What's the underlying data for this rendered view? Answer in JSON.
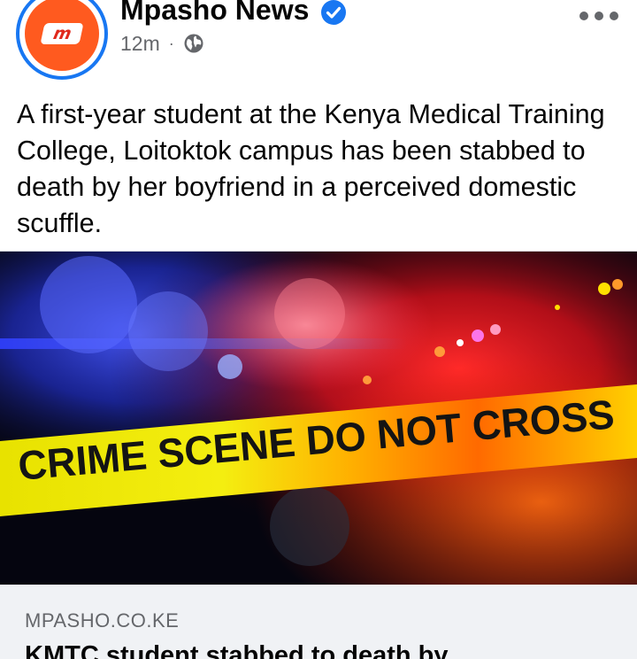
{
  "post": {
    "page_name": "Mpasho News",
    "verified": true,
    "timestamp": "12m",
    "separator": "·",
    "audience_icon": "globe-icon",
    "more_icon": "more-options-icon",
    "avatar_logo_text": "m",
    "text": "A first-year student at the Kenya Medical Training College, Loitoktok campus has been stabbed to death by her boyfriend in a perceived domestic scuffle."
  },
  "media": {
    "description_icon": "crime-scene-photo",
    "tape_text": "CRIME SCENE DO NOT CROSS"
  },
  "link_preview": {
    "domain": "MPASHO.CO.KE",
    "title": "KMTC student stabbed to death by"
  },
  "colors": {
    "brand_blue": "#1877f2",
    "avatar_orange": "#ff5a1f",
    "text_primary": "#050505",
    "text_secondary": "#65676b",
    "tape_yellow": "#f2e600"
  }
}
